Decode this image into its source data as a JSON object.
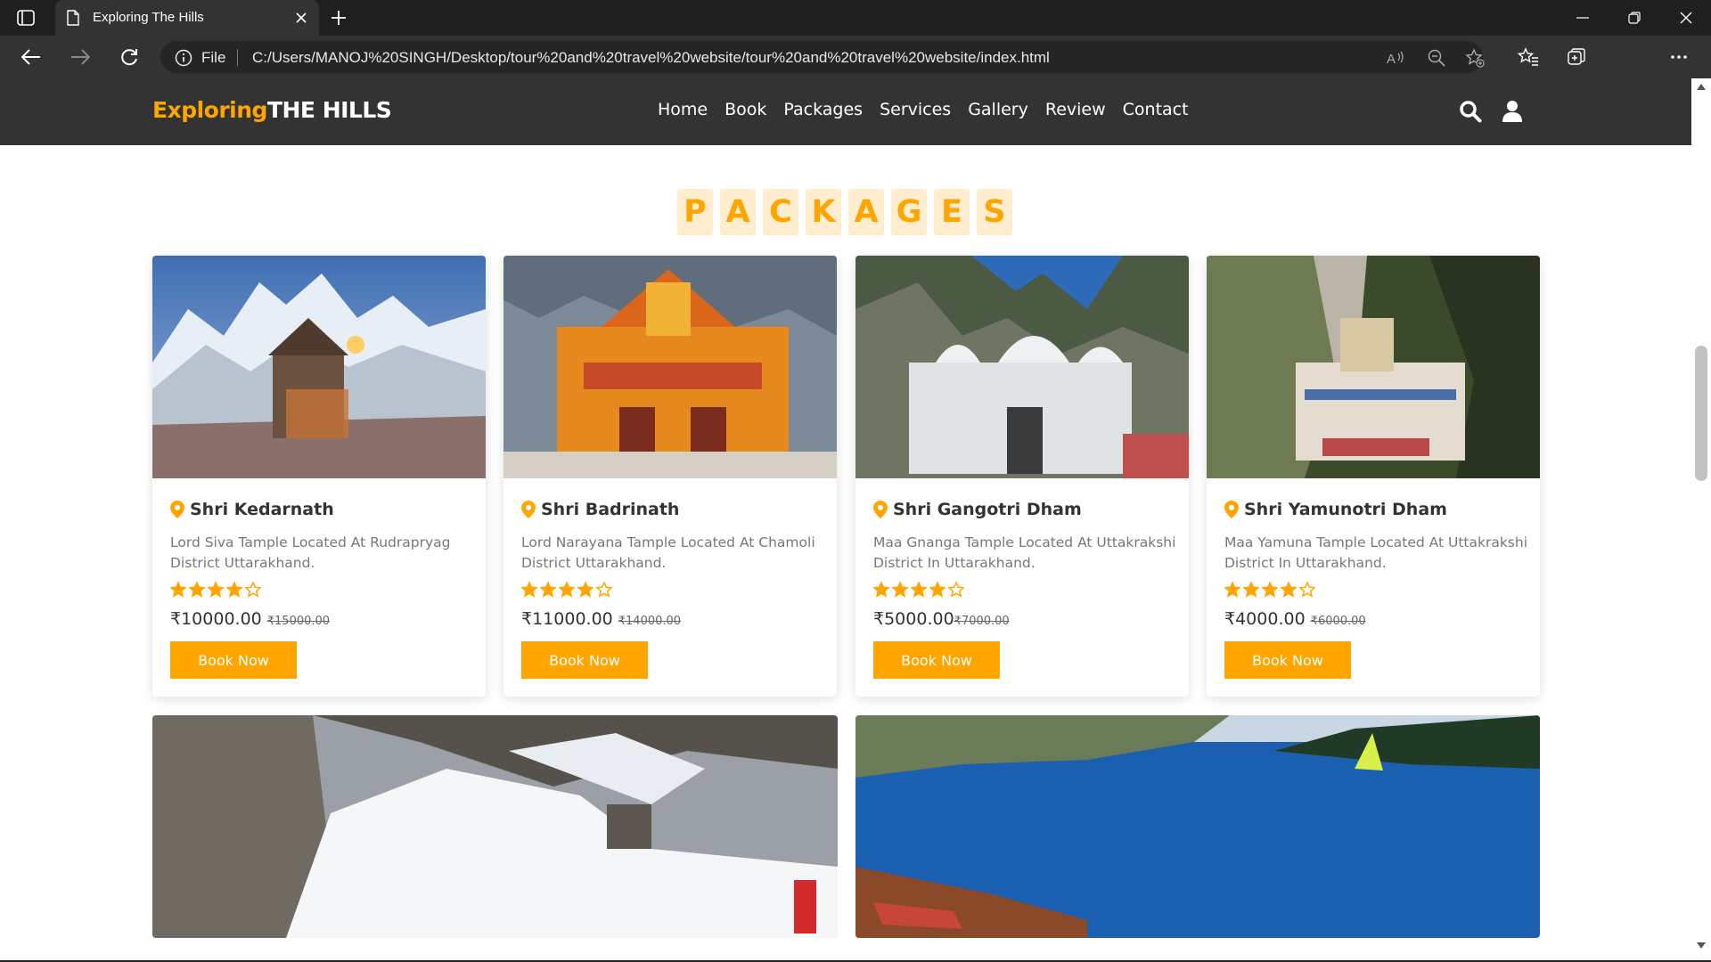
{
  "browser": {
    "tab_title": "Exploring The Hills",
    "file_label": "File",
    "url": "C:/Users/MANOJ%20SINGH/Desktop/tour%20and%20travel%20website/tour%20and%20travel%20website/index.html"
  },
  "site": {
    "logo_part1": "Exploring",
    "logo_part2": "THE HILLS",
    "nav": [
      "Home",
      "Book",
      "Packages",
      "Services",
      "Gallery",
      "Review",
      "Contact"
    ]
  },
  "packages": {
    "heading_letters": [
      "P",
      "A",
      "C",
      "K",
      "A",
      "G",
      "E",
      "S"
    ],
    "cards": [
      {
        "name": "Shri Kedarnath",
        "description": "Lord Siva Tample Located At Rudrapryag District Uttarakhand.",
        "rating": 4,
        "price": "₹10000.00",
        "old_price": "₹15000.00",
        "button": "Book Now"
      },
      {
        "name": "Shri Badrinath",
        "description": "Lord Narayana Tample Located At Chamoli District Uttarakhand.",
        "rating": 4,
        "price": "₹11000.00",
        "old_price": "₹14000.00",
        "button": "Book Now"
      },
      {
        "name": "Shri Gangotri Dham",
        "description": "Maa Gnanga Tample Located At Uttakrakshi District In Uttarakhand.",
        "rating": 4,
        "price": "₹5000.00",
        "old_price": "₹7000.00",
        "button": "Book Now"
      },
      {
        "name": "Shri Yamunotri Dham",
        "description": "Maa Yamuna Tample Located At Uttakrakshi District In Uttarakhand.",
        "rating": 4,
        "price": "₹4000.00",
        "old_price": "₹6000.00",
        "button": "Book Now"
      }
    ]
  },
  "colors": {
    "accent": "#ffa500",
    "header_bg": "#333333",
    "heading_bg": "#ffedd0"
  }
}
